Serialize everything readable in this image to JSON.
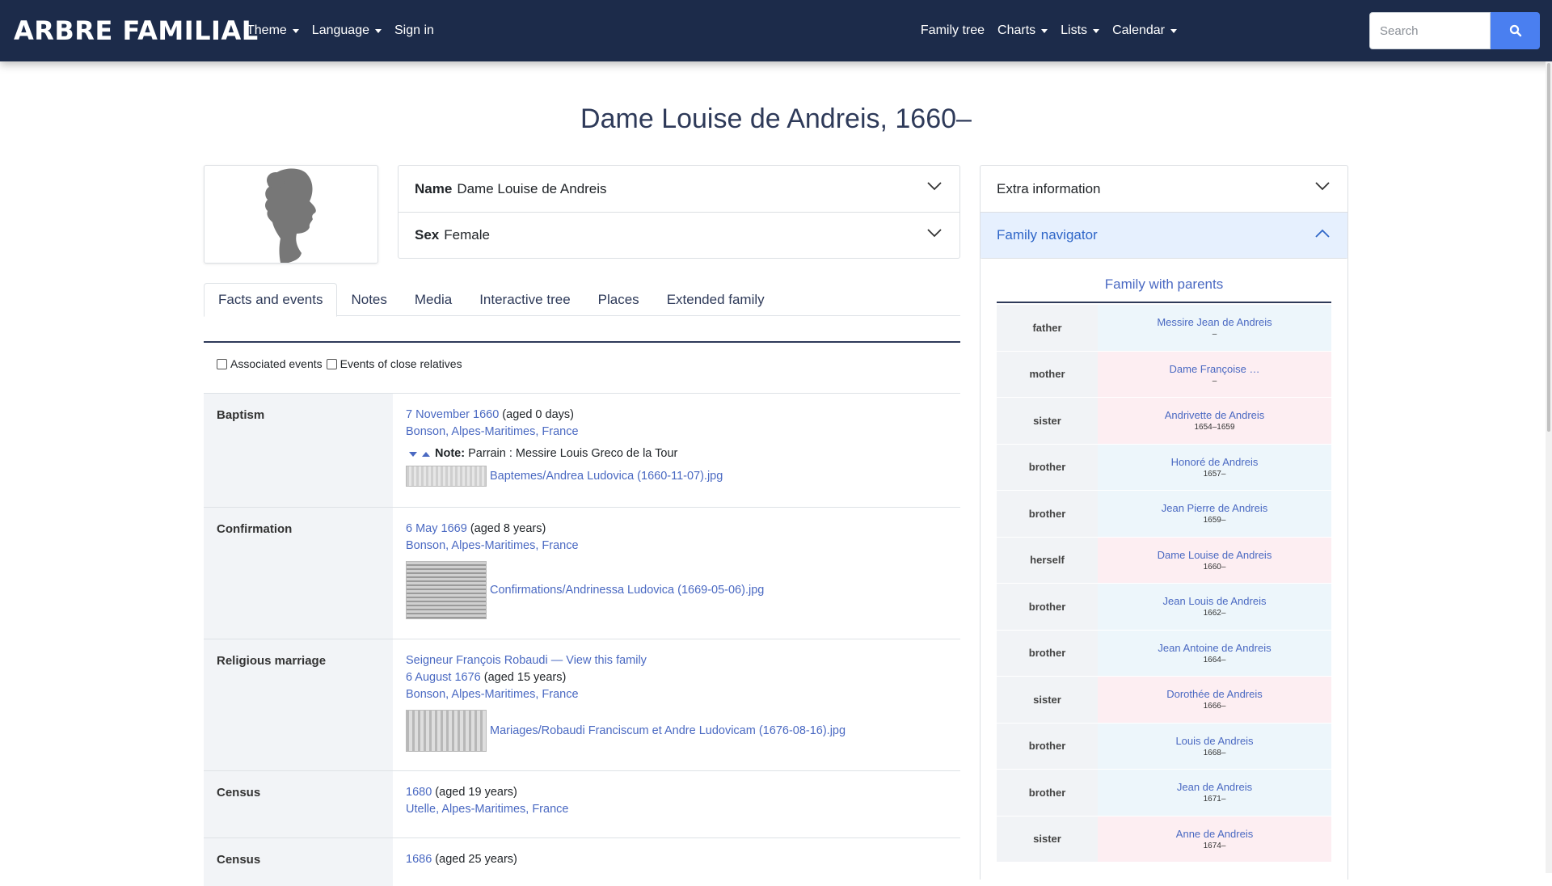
{
  "brand": "ARBRE FAMILIAL",
  "nav_left": [
    {
      "label": "Theme",
      "dropdown": true
    },
    {
      "label": "Language",
      "dropdown": true
    },
    {
      "label": "Sign in",
      "dropdown": false
    }
  ],
  "nav_right": [
    {
      "label": "Family tree",
      "dropdown": false
    },
    {
      "label": "Charts",
      "dropdown": true
    },
    {
      "label": "Lists",
      "dropdown": true
    },
    {
      "label": "Calendar",
      "dropdown": true
    }
  ],
  "search": {
    "placeholder": "Search",
    "icon": "search-icon"
  },
  "colors": {
    "navbar": "#1c2b4a",
    "accent": "#4a7ff0",
    "link": "#4a69c2",
    "male_bg": "#edf6fb",
    "female_bg": "#fdeef2"
  },
  "title": "Dame Louise de Andreis, 1660–",
  "summary": {
    "name_label": "Name",
    "name_value": "Dame Louise de Andreis",
    "sex_label": "Sex",
    "sex_value": "Female"
  },
  "sidebar_accordion": {
    "extra": "Extra information",
    "navigator": "Family navigator"
  },
  "tabs": [
    "Facts and events",
    "Notes",
    "Media",
    "Interactive tree",
    "Places",
    "Extended family"
  ],
  "filters": {
    "associated": "Associated events",
    "close_relatives": "Events of close relatives"
  },
  "facts": [
    {
      "label": "Baptism",
      "date": "7 November 1660",
      "age": "(aged 0 days)",
      "place": "Bonson, Alpes-Maritimes, France",
      "note_label": "Note:",
      "note_text": "Parrain : Messire Louis Greco de la Tour",
      "media": "Baptemes/Andrea Ludovica (1660-11-07).jpg"
    },
    {
      "label": "Confirmation",
      "date": "6 May 1669",
      "age": "(aged 8 years)",
      "place": "Bonson, Alpes-Maritimes, France",
      "media": "Confirmations/Andrinessa Ludovica (1669-05-06).jpg"
    },
    {
      "label": "Religious marriage",
      "spouse": "Seigneur François Robaudi",
      "view_family": "— View this family",
      "date": "6 August 1676",
      "age": "(aged 15 years)",
      "place": "Bonson, Alpes-Maritimes, France",
      "media": "Mariages/Robaudi Franciscum et Andre Ludovicam (1676-08-16).jpg"
    },
    {
      "label": "Census",
      "date": "1680",
      "age": "(aged 19 years)",
      "place": "Utelle, Alpes-Maritimes, France"
    },
    {
      "label": "Census",
      "date": "1686",
      "age": "(aged 25 years)"
    }
  ],
  "family": {
    "heading": "Family with parents",
    "members": [
      {
        "rel": "father",
        "name": "Messire Jean de Andreis",
        "dates": "–",
        "sex": "m"
      },
      {
        "rel": "mother",
        "name": "Dame Françoise …",
        "dates": "–",
        "sex": "f"
      },
      {
        "rel": "sister",
        "name": "Andrivette de Andreis",
        "dates": "1654–1659",
        "sex": "f"
      },
      {
        "rel": "brother",
        "name": "Honoré de Andreis",
        "dates": "1657–",
        "sex": "m"
      },
      {
        "rel": "brother",
        "name": "Jean Pierre de Andreis",
        "dates": "1659–",
        "sex": "m"
      },
      {
        "rel": "herself",
        "name": "Dame Louise de Andreis",
        "dates": "1660–",
        "sex": "f"
      },
      {
        "rel": "brother",
        "name": "Jean Louis de Andreis",
        "dates": "1662–",
        "sex": "m"
      },
      {
        "rel": "brother",
        "name": "Jean Antoine de Andreis",
        "dates": "1664–",
        "sex": "m"
      },
      {
        "rel": "sister",
        "name": "Dorothée de Andreis",
        "dates": "1666–",
        "sex": "f"
      },
      {
        "rel": "brother",
        "name": "Louis de Andreis",
        "dates": "1668–",
        "sex": "m"
      },
      {
        "rel": "brother",
        "name": "Jean de Andreis",
        "dates": "1671–",
        "sex": "m"
      },
      {
        "rel": "sister",
        "name": "Anne de Andreis",
        "dates": "1674–",
        "sex": "f"
      }
    ]
  }
}
